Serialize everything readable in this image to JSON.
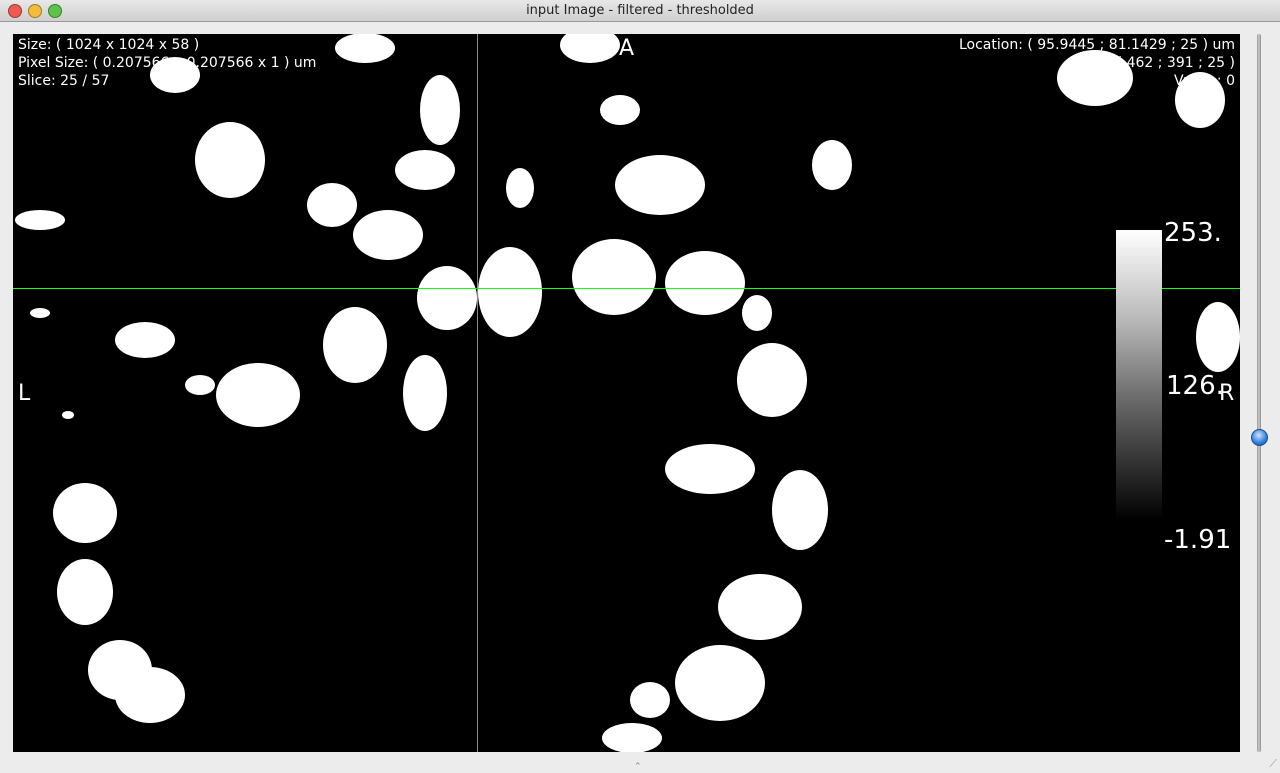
{
  "window": {
    "title": "input Image - filtered - thresholded"
  },
  "overlay": {
    "size": "Size: ( 1024 x 1024 x 58 )",
    "pixel_size": "Pixel Size: ( 0.207566 x 0.207566 x 1 ) um",
    "slice": "Slice: 25 / 57",
    "location": "Location: ( 95.9445 ; 81.1429 ; 25 ) um",
    "index": "Index: ( 462 ; 391 ; 25 )",
    "value": "Value : 0"
  },
  "orientation": {
    "top": "A",
    "left": "L",
    "right": "R"
  },
  "colorbar": {
    "max": "253.",
    "mid": "126.",
    "min": "-1.91"
  },
  "slider": {
    "value": 25,
    "max": 57
  },
  "colors": {
    "crosshair_h": "#1aff1a",
    "crosshair_v": "#888888"
  }
}
